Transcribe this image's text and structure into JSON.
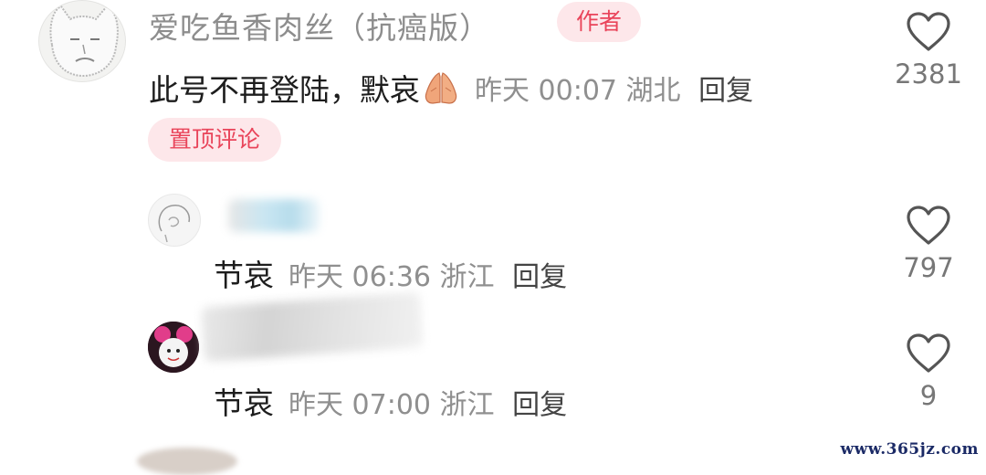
{
  "main_comment": {
    "author": "爱吃鱼香肉丝（抗癌版）",
    "author_badge": "作者",
    "text": "此号不再登陆，默哀",
    "time": "昨天 00:07",
    "location": "湖北",
    "reply_label": "回复",
    "pinned_label": "置顶评论",
    "likes": "2381"
  },
  "replies": [
    {
      "text": "节哀",
      "time": "昨天 06:36",
      "location": "浙江",
      "reply_label": "回复",
      "likes": "797"
    },
    {
      "text": "节哀",
      "time": "昨天 07:00",
      "location": "浙江",
      "reply_label": "回复",
      "likes": "9"
    }
  ],
  "icons": {
    "like": "heart-outline-icon",
    "emoji": "folded-hands-icon"
  },
  "colors": {
    "badge_text": "#e9445a",
    "badge_bg": "#fde7ea",
    "meta_gray": "#8f8f8f"
  },
  "watermark": "www.365jz.com"
}
